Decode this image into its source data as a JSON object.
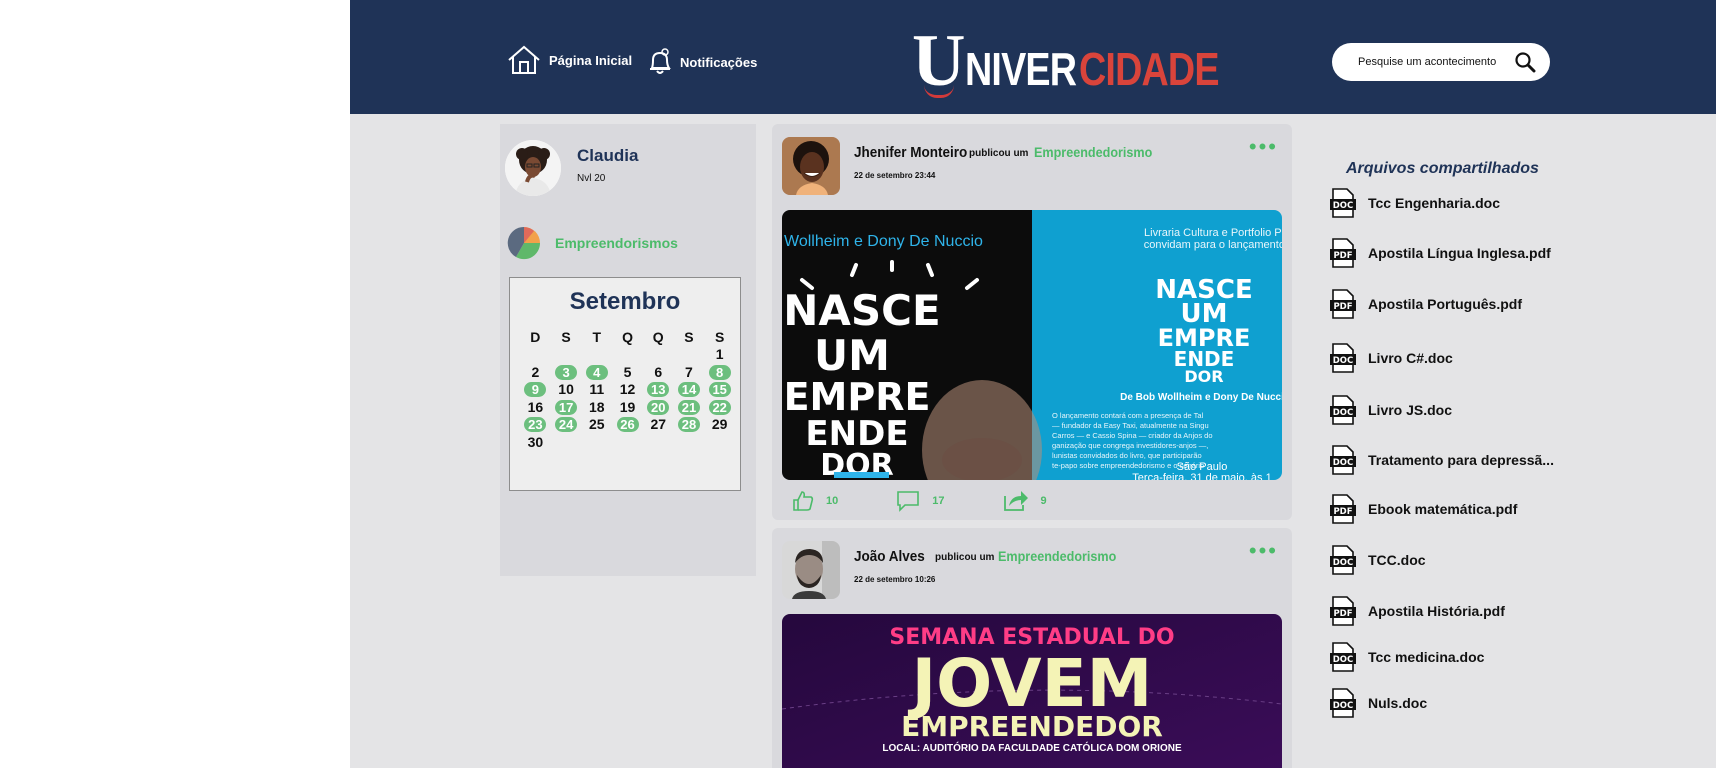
{
  "header": {
    "nav": [
      {
        "label": "Página Inicial",
        "icon": "home-icon"
      },
      {
        "label": "Notificações",
        "icon": "bell-icon"
      }
    ],
    "logo": {
      "part1": "U",
      "part2": "NIVER",
      "part3": "CIDADE"
    },
    "search": {
      "placeholder": "Pesquise um acontecimento",
      "icon": "search-icon"
    }
  },
  "profile": {
    "name": "Claudia",
    "level": "Nvl 20",
    "interest": "Empreendorismos"
  },
  "calendar": {
    "month": "Setembro",
    "weekdays": [
      "D",
      "S",
      "T",
      "Q",
      "Q",
      "S",
      "S"
    ],
    "weeks": [
      [
        null,
        null,
        null,
        null,
        null,
        null,
        {
          "d": "1",
          "m": false
        }
      ],
      [
        {
          "d": "2",
          "m": false
        },
        {
          "d": "3",
          "m": true
        },
        {
          "d": "4",
          "m": true
        },
        {
          "d": "5",
          "m": false
        },
        {
          "d": "6",
          "m": false
        },
        {
          "d": "7",
          "m": false
        },
        {
          "d": "8",
          "m": true
        }
      ],
      [
        {
          "d": "9",
          "m": true
        },
        {
          "d": "10",
          "m": false
        },
        {
          "d": "11",
          "m": false
        },
        {
          "d": "12",
          "m": false
        },
        {
          "d": "13",
          "m": true
        },
        {
          "d": "14",
          "m": true
        },
        {
          "d": "15",
          "m": true
        }
      ],
      [
        {
          "d": "16",
          "m": false
        },
        {
          "d": "17",
          "m": true
        },
        {
          "d": "18",
          "m": false
        },
        {
          "d": "19",
          "m": false
        },
        {
          "d": "20",
          "m": true
        },
        {
          "d": "21",
          "m": true
        },
        {
          "d": "22",
          "m": true
        }
      ],
      [
        {
          "d": "23",
          "m": true
        },
        {
          "d": "24",
          "m": true
        },
        {
          "d": "25",
          "m": false
        },
        {
          "d": "26",
          "m": true
        },
        {
          "d": "27",
          "m": false
        },
        {
          "d": "28",
          "m": true
        },
        {
          "d": "29",
          "m": false
        }
      ],
      [
        {
          "d": "30",
          "m": false
        },
        null,
        null,
        null,
        null,
        null,
        null
      ]
    ]
  },
  "posts": [
    {
      "author": "Jhenifer Monteiro",
      "action": "publicou um",
      "topic": "Empreendedorismo",
      "date": "22 de setembro 23:44",
      "menu": "•••",
      "image": {
        "left_top": "Wollheim e Dony De Nuccio",
        "left_lines": [
          "NASCE",
          "UM",
          "EMPRE",
          "ENDE",
          "DOR"
        ],
        "right_top": "Livraria Cultura e Portfolio Peng",
        "right_top2": "convidam para o lançamento do",
        "right_lines": [
          "NASCE",
          "UM",
          "EMPRE",
          "ENDE",
          "DOR"
        ],
        "right_author": "De Bob Wollheim e Dony De Nucci",
        "right_body": [
          "O lançamento contará com a presença de Tal",
          "— fundador da Easy Taxi, atualmente na Singu",
          "Carros — e Cassio Spina — criador da Anjos do",
          "ganização que congrega investidores-anjos —,",
          "lunistas convidados do livro, que participarão",
          "te-papo sobre empreendedorismo e o cenário"
        ],
        "right_city": "São Paulo",
        "right_date": "Terça-feira, 31 de maio, às 1"
      },
      "likes": "10",
      "comments": "17",
      "shares": "9"
    },
    {
      "author": "João Alves",
      "action": "publicou um",
      "topic": "Empreendedorismo",
      "date": "22 de setembro 10:26",
      "menu": "•••",
      "image": {
        "line1": "SEMANA ESTADUAL DO",
        "line2": "JOVEM",
        "line3": "EMPREENDEDOR",
        "line4": "LOCAL: AUDITÓRIO DA FACULDADE CATÓLICA DOM ORIONE"
      }
    }
  ],
  "files": {
    "title": "Arquivos compartilhados",
    "items": [
      {
        "name": "Tcc Engenharia.doc",
        "type": "DOC"
      },
      {
        "name": "Apostila Língua Inglesa.pdf",
        "type": "PDF"
      },
      {
        "name": "Apostila Português.pdf",
        "type": "PDF"
      },
      {
        "name": "Livro C#.doc",
        "type": "DOC"
      },
      {
        "name": "Livro JS.doc",
        "type": "DOC"
      },
      {
        "name": "Tratamento para depressã...",
        "type": "DOC"
      },
      {
        "name": "Ebook matemática.pdf",
        "type": "PDF"
      },
      {
        "name": "TCC.doc",
        "type": "DOC"
      },
      {
        "name": "Apostila História.pdf",
        "type": "PDF"
      },
      {
        "name": "Tcc medicina.doc",
        "type": "DOC"
      },
      {
        "name": "Nuls.doc",
        "type": "DOC"
      }
    ]
  },
  "colors": {
    "header": "#1f3357",
    "accent": "#4cbb6a",
    "logo_red": "#d9443b"
  }
}
